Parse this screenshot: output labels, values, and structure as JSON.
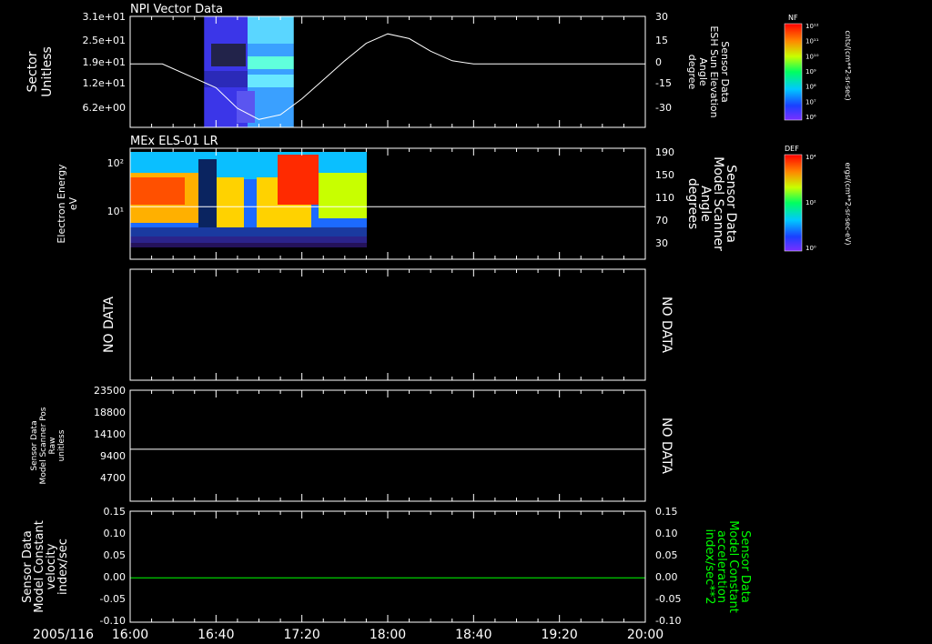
{
  "footer": {
    "date": "2005/116"
  },
  "time_axis": {
    "start": "16:00",
    "end": "20:00",
    "ticks": [
      "16:00",
      "16:40",
      "17:20",
      "18:00",
      "18:40",
      "19:20",
      "20:00"
    ]
  },
  "colorbars": [
    {
      "tag": "NF",
      "unit": "cnts/(cm**2-sr-sec)",
      "tick_labels": [
        "10¹²",
        "10¹¹",
        "10¹⁰",
        "10⁹",
        "10⁸",
        "10⁷",
        "10⁶"
      ]
    },
    {
      "tag": "DEF",
      "unit": "ergs/(cm**2-sr-sec-eV)",
      "tick_labels": [
        "10⁴",
        "10²",
        "10⁰"
      ]
    }
  ],
  "panels": [
    {
      "title": "NPI Vector Data",
      "left_label": [
        "Sector",
        "Unitless"
      ],
      "left_ticks": [
        "3.1e+01",
        "2.5e+01",
        "1.9e+01",
        "1.2e+01",
        "6.2e+00"
      ],
      "right_label": [
        "Sensor Data",
        "ESH Sun Elevation",
        "Angle",
        "degree"
      ],
      "right_ticks": [
        "30",
        "15",
        "0",
        "-15",
        "-30"
      ]
    },
    {
      "title": "MEx ELS-01 LR",
      "left_label": [
        "Electron Energy",
        "eV"
      ],
      "left_ticks": [
        "10²",
        "10¹"
      ],
      "right_label": [
        "Sensor Data",
        "Model Scanner",
        "Angle",
        "degrees"
      ],
      "right_ticks": [
        "190",
        "150",
        "110",
        "70",
        "30"
      ]
    },
    {
      "left_label": [
        "NO DATA"
      ],
      "right_label": [
        "NO DATA"
      ]
    },
    {
      "left_label": [
        "Sensor Data",
        "Model Scanner Pos",
        "Raw",
        "unitless"
      ],
      "left_ticks": [
        "23500",
        "18800",
        "14100",
        "9400",
        "4700"
      ],
      "right_label": [
        "NO DATA"
      ]
    },
    {
      "left_label": [
        "Sensor Data",
        "Model Constant",
        "velocity",
        "index/sec"
      ],
      "left_ticks": [
        "0.15",
        "0.10",
        "0.05",
        "0.00",
        "-0.05",
        "-0.10"
      ],
      "right_label": [
        "Sensor Data",
        "Model Constant",
        "acceleration",
        "index/sec**2"
      ],
      "right_ticks": [
        "0.15",
        "0.10",
        "0.05",
        "0.00",
        "-0.05",
        "-0.10"
      ]
    }
  ],
  "chart_data": [
    {
      "type": "line",
      "title": "NPI Vector Data",
      "series": [],
      "background": {
        "type": "heatmap",
        "x_range": [
          "16:40",
          "17:20"
        ]
      },
      "x": [
        "16:00",
        "16:15",
        "16:40",
        "16:50",
        "17:00",
        "17:10",
        "17:20",
        "17:30",
        "17:40",
        "17:50",
        "18:00",
        "18:10",
        "18:20",
        "18:30",
        "18:40",
        "20:00"
      ],
      "values": [
        0,
        0,
        -15,
        -28,
        -35,
        -32,
        -22,
        -10,
        2,
        13,
        19,
        16,
        8,
        2,
        0,
        0
      ],
      "y_axis": "right",
      "ylim_right": [
        -40,
        30
      ],
      "yticks_right": [
        30,
        15,
        0,
        -15,
        -30
      ],
      "yticks_left": [
        "3.1e+01",
        "2.5e+01",
        "1.9e+01",
        "1.2e+01",
        "6.2e+00"
      ],
      "xlim": [
        "16:00",
        "20:00"
      ]
    },
    {
      "type": "heatmap",
      "title": "MEx ELS-01 LR",
      "x_range": [
        "16:00",
        "17:55"
      ],
      "yscale": "log",
      "ylim_left": [
        1,
        200
      ],
      "yticks_left": [
        100,
        10
      ],
      "ylim_right": [
        0,
        190
      ],
      "yticks_right": [
        190,
        150,
        110,
        70,
        30
      ],
      "series": [],
      "line_value_right": 90
    },
    {
      "type": "line",
      "series": []
    },
    {
      "type": "line",
      "series": [],
      "ylim": [
        0,
        23500
      ],
      "yticks": [
        23500,
        18800,
        14100,
        9400,
        4700
      ],
      "x": [
        "16:00",
        "20:00"
      ],
      "values": [
        11000,
        11000
      ]
    },
    {
      "type": "line",
      "series": [],
      "ylim": [
        -0.1,
        0.15
      ],
      "yticks": [
        0.15,
        0.1,
        0.05,
        0.0,
        -0.05,
        -0.1
      ],
      "x": [
        "16:00",
        "20:00"
      ],
      "values": [
        0.0,
        0.0
      ],
      "color": "#00ff00"
    }
  ]
}
